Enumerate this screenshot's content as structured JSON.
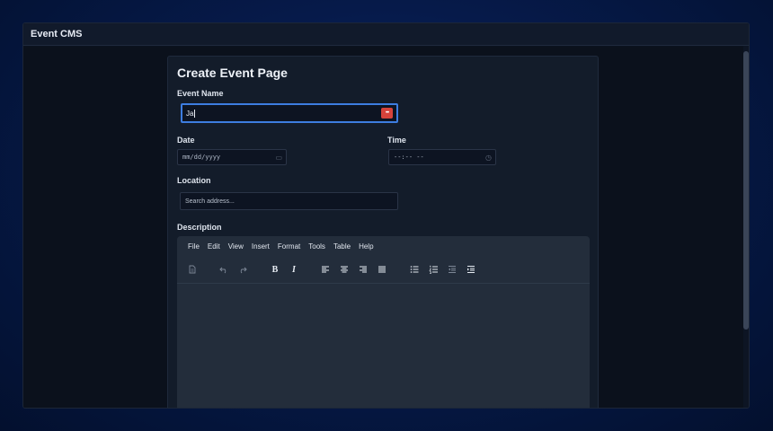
{
  "window": {
    "title": "Event CMS"
  },
  "form": {
    "title": "Create Event Page",
    "event_name_label": "Event Name",
    "event_name_value": "Ja",
    "password_icon_text": "•••",
    "date_label": "Date",
    "date_placeholder": "mm/dd/yyyy",
    "time_label": "Time",
    "time_placeholder": "--:-- --",
    "location_label": "Location",
    "location_placeholder": "Search address...",
    "description_label": "Description"
  },
  "editor": {
    "menu": [
      "File",
      "Edit",
      "View",
      "Insert",
      "Format",
      "Tools",
      "Table",
      "Help"
    ],
    "bold_label": "B",
    "italic_label": "I"
  },
  "icons": {
    "date": "calendar-icon",
    "time": "clock-icon",
    "password": "password-manager-icon"
  },
  "colors": {
    "accent": "#3d7de0",
    "password_icon": "#d6433b",
    "background": "#0b111c"
  }
}
